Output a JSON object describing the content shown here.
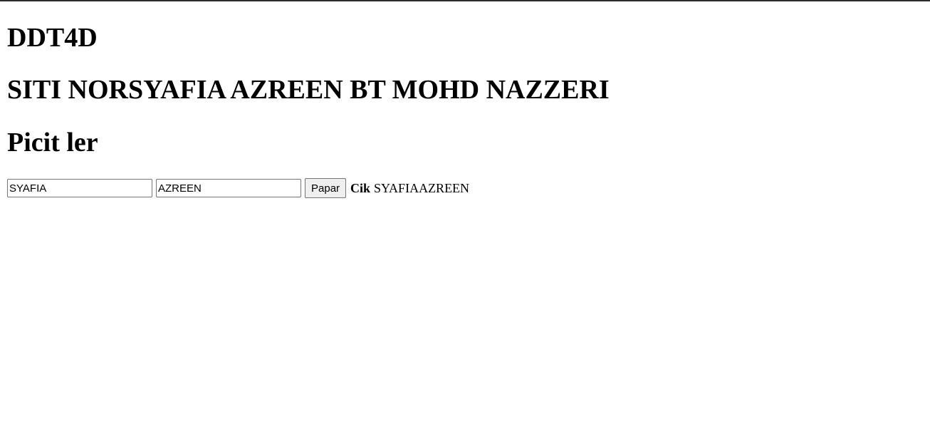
{
  "page": {
    "title": "DDT4D",
    "name": "SITI NORSYAFIA AZREEN BT MOHD NAZZERI",
    "subtitle": "Picit ler"
  },
  "form": {
    "first_value": "SYAFIA",
    "second_value": "AZREEN",
    "button_label": "Papar",
    "result_label": "Cik",
    "result_value": "SYAFIAAZREEN"
  }
}
